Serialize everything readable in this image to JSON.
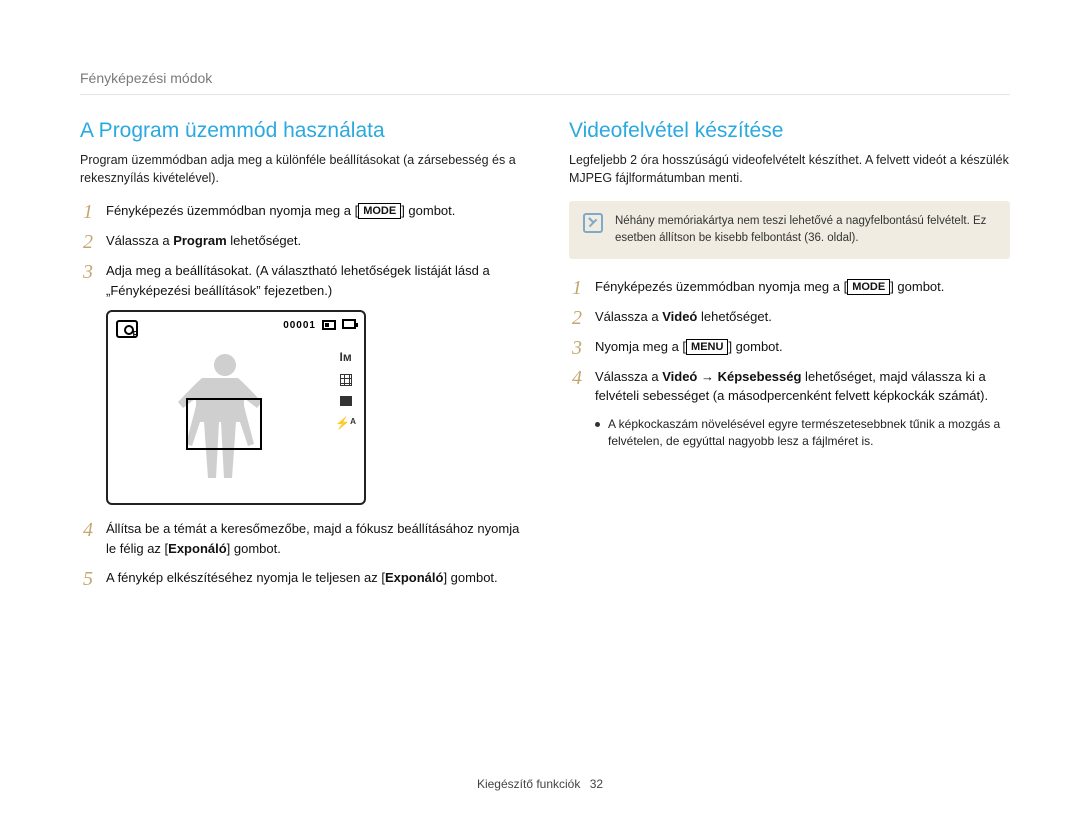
{
  "section_label": "Fényképezési módok",
  "left": {
    "heading": "A Program üzemmód használata",
    "intro": "Program üzemmódban adja meg a különféle beállításokat (a zársebesség és a rekesznyílás kivételével).",
    "steps": {
      "s1a": "Fényképezés üzemmódban nyomja meg a [",
      "s1_mode": "MODE",
      "s1b": "] gombot.",
      "s2a": "Válassza a ",
      "s2_bold": "Program",
      "s2b": " lehetőséget.",
      "s3": "Adja meg a beállításokat. (A választható lehetőségek listáját lásd a „Fényképezési beállítások” fejezetben.)",
      "s4a": "Állítsa be a témát a keresőmezőbe, majd a fókusz beállításához nyomja le félig az [",
      "s4_bold": "Exponáló",
      "s4b": "] gombot.",
      "s5a": "A fénykép elkészítéséhez nyomja le teljesen az [",
      "s5_bold": "Exponáló",
      "s5b": "] gombot."
    },
    "camera": {
      "counter": "00001",
      "side_im": "Iм",
      "side_flash": "⚡ᴬ"
    }
  },
  "right": {
    "heading": "Videofelvétel készítése",
    "intro": "Legfeljebb 2 óra hosszúságú videofelvételt készíthet. A felvett videót a készülék MJPEG fájlformátumban menti.",
    "note": "Néhány memóriakártya nem teszi lehetővé a nagyfelbontású felvételt. Ez esetben állítson be kisebb felbontást (36. oldal).",
    "steps": {
      "s1a": "Fényképezés üzemmódban nyomja meg a [",
      "s1_mode": "MODE",
      "s1b": "] gombot.",
      "s2a": "Válassza a ",
      "s2_bold": "Videó",
      "s2b": " lehetőséget.",
      "s3a": "Nyomja meg a [",
      "s3_menu": "MENU",
      "s3b": "] gombot.",
      "s4a": "Válassza a ",
      "s4_bold1": "Videó",
      "s4_arrow": " → ",
      "s4_bold2": "Képsebesség",
      "s4b": " lehetőséget, majd válassza ki a felvételi sebességet (a másodpercenként felvett képkockák számát).",
      "s4_sub": "A képkockaszám növelésével egyre természetesebbnek tűnik a mozgás a felvételen, de egyúttal nagyobb lesz a fájlméret is."
    }
  },
  "footer": {
    "label": "Kiegészítő funkciók",
    "page": "32"
  }
}
